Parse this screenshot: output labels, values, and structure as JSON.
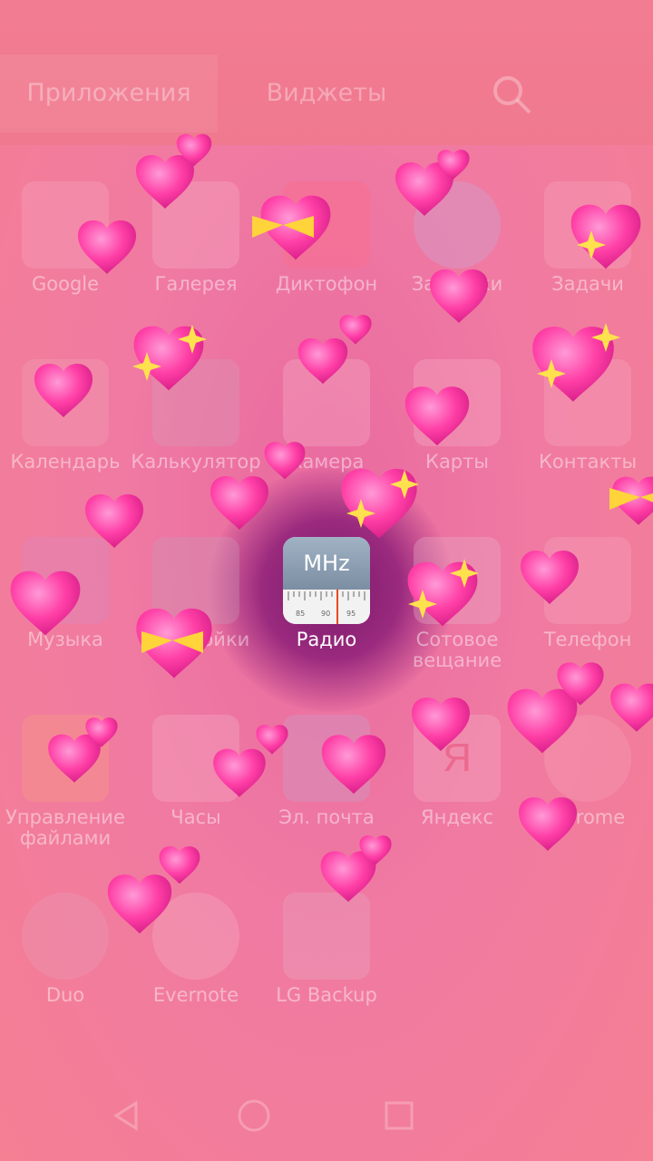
{
  "tabs": {
    "apps": "Приложения",
    "widgets": "Виджеты"
  },
  "apps": [
    {
      "label": "Google",
      "color": "#f7a6bf",
      "icon": "google-folder-icon"
    },
    {
      "label": "Галерея",
      "color": "#f5b0c6",
      "icon": "gallery-icon"
    },
    {
      "label": "Диктофон",
      "color": "#ff6b86",
      "icon": "voice-recorder-icon"
    },
    {
      "label": "Загрузки",
      "color": "#c8a9d8",
      "icon": "download-icon"
    },
    {
      "label": "Задачи",
      "color": "#f7a6bf",
      "icon": "tasks-icon"
    },
    {
      "label": "Календарь",
      "color": "#f0a0b8",
      "icon": "calendar-icon"
    },
    {
      "label": "Калькулятор",
      "color": "#d69ab8",
      "icon": "calculator-icon"
    },
    {
      "label": "Камера",
      "color": "#f5b0c6",
      "icon": "camera-icon"
    },
    {
      "label": "Карты",
      "color": "#f5b0c6",
      "icon": "maps-icon"
    },
    {
      "label": "Контакты",
      "color": "#f7a6bf",
      "icon": "contacts-icon"
    },
    {
      "label": "Музыка",
      "color": "#d88ac0",
      "icon": "music-icon"
    },
    {
      "label": "Настройки",
      "color": "#c898b8",
      "icon": "settings-icon"
    },
    {
      "label": "Радио",
      "color": "#f4f4f4",
      "icon": "radio-icon",
      "top_text": "MHz",
      "scale": [
        "85",
        "90",
        "95"
      ]
    },
    {
      "label": "Сотовое вещание",
      "color": "#e8b0c8",
      "icon": "cell-broadcast-icon"
    },
    {
      "label": "Телефон",
      "color": "#f7a6bf",
      "icon": "phone-icon"
    },
    {
      "label": "Управление файлами",
      "color": "#f6a080",
      "icon": "file-manager-icon"
    },
    {
      "label": "Часы",
      "color": "#f5b0c6",
      "icon": "clock-icon"
    },
    {
      "label": "Эл. почта",
      "color": "#c8a0c8",
      "icon": "email-icon"
    },
    {
      "label": "Яндекс",
      "color": "#f5b0c6",
      "icon": "yandex-icon",
      "glyph": "Я"
    },
    {
      "label": "Chrome",
      "color": "#f5a0b8",
      "icon": "chrome-icon"
    },
    {
      "label": "Duo",
      "color": "#e89ab8",
      "icon": "duo-icon"
    },
    {
      "label": "Evernote",
      "color": "#f5b0c6",
      "icon": "evernote-icon"
    },
    {
      "label": "LG Backup",
      "color": "#e8a6c0",
      "icon": "lg-backup-icon"
    }
  ],
  "nav": {
    "back": "back-icon",
    "home": "home-icon",
    "recents": "recents-icon"
  },
  "colors": {
    "heart": "#ff3fa6",
    "bow": "#ffd43b",
    "sparkle": "#ffe14d"
  }
}
